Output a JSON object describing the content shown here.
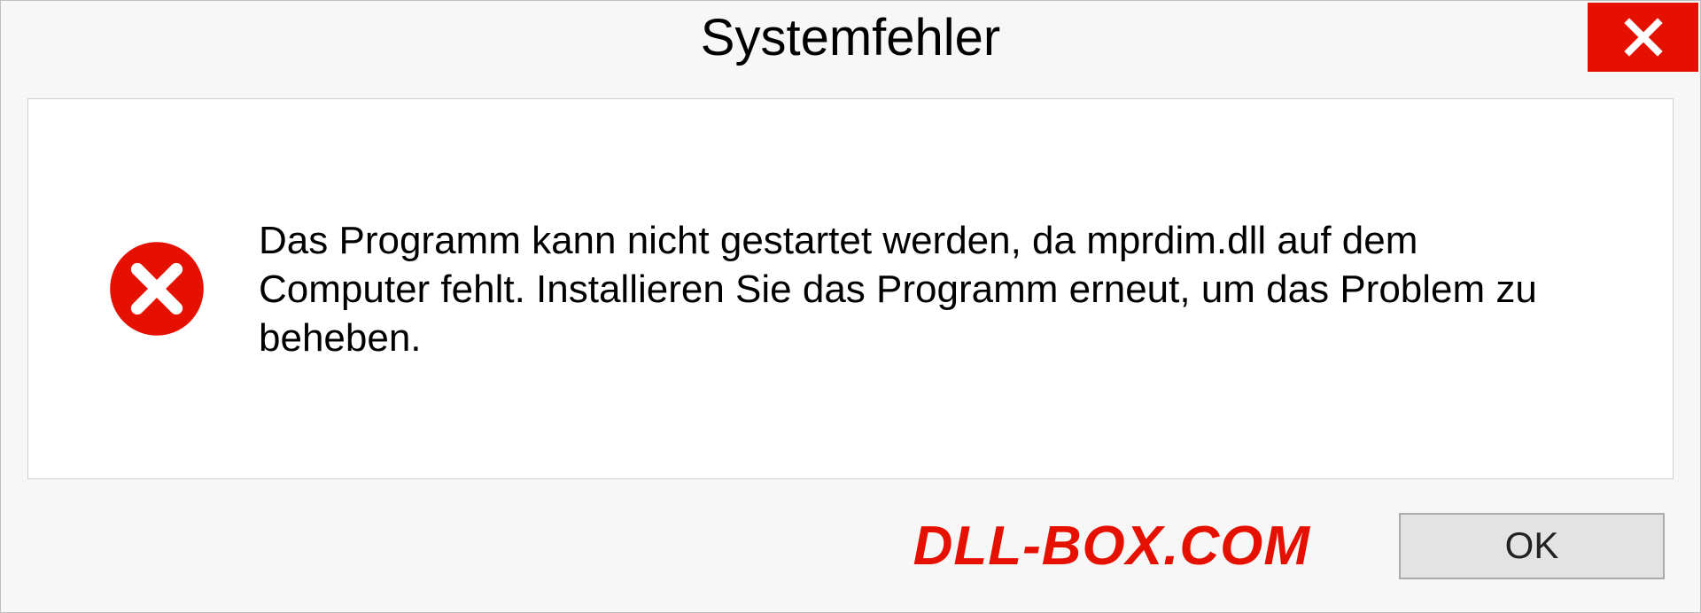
{
  "dialog": {
    "title": "Systemfehler",
    "message": "Das Programm kann nicht gestartet werden, da mprdim.dll auf dem Computer fehlt. Installieren Sie das Programm erneut, um das Problem zu beheben.",
    "ok_label": "OK",
    "watermark": "DLL-BOX.COM",
    "close_icon": "close-icon",
    "error_icon": "error-icon",
    "accent_color": "#e61000"
  }
}
